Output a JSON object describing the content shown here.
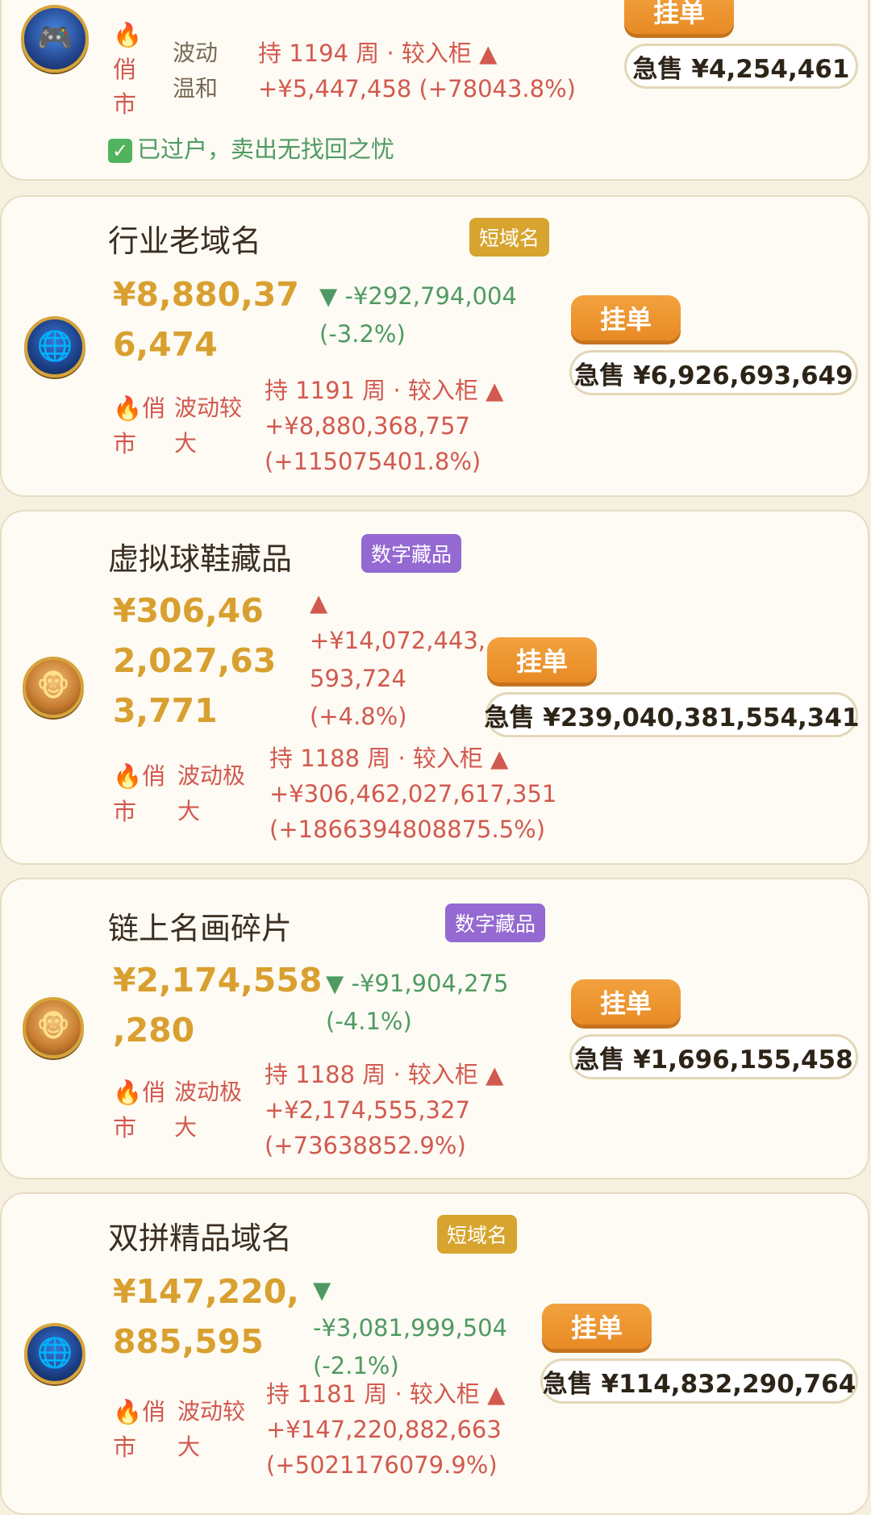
{
  "cards": [
    {
      "title": "",
      "tag": "",
      "price_lines": "",
      "change": "",
      "hot": "🔥\n俏\n市",
      "volatility": "波动\n温和",
      "hold": "持 1194 周 · 较入柜 ▲\n+¥5,447,458 (+78043.8%)",
      "list_label": "挂单",
      "sell_label": "急售 ¥4,254,461",
      "verified": "已过户，卖出无找回之忧",
      "avatar_icon": "gamer-avatar-icon"
    },
    {
      "title": "行业老域名",
      "tag": "短域名",
      "price_lines": "¥8,880,37\n6,474",
      "change": "▼ -¥292,794,004\n(-3.2%)",
      "hot": "🔥俏\n市",
      "volatility": "波动较\n大",
      "hold": "持 1191 周 · 较入柜 ▲\n+¥8,880,368,757\n(+115075401.8%)",
      "list_label": "挂单",
      "sell_label": "急售 ¥6,926,693,649",
      "avatar_icon": "globe-domain-icon"
    },
    {
      "title": "虚拟球鞋藏品",
      "tag": "数字藏品",
      "price_lines": "¥306,46\n2,027,63\n3,771",
      "change": "▲\n+¥14,072,443,\n593,724\n(+4.8%)",
      "hot": "🔥俏\n市",
      "volatility": "波动极\n大",
      "hold": "持 1188 周 · 较入柜 ▲\n+¥306,462,027,617,351\n(+1866394808875.5%)",
      "list_label": "挂单",
      "sell_label": "急售 ¥239,040,381,554,341",
      "avatar_icon": "monkey-nft-icon"
    },
    {
      "title": "链上名画碎片",
      "tag": "数字藏品",
      "price_lines": "¥2,174,558\n,280",
      "change": "▼ -¥91,904,275\n(-4.1%)",
      "hot": "🔥俏\n市",
      "volatility": "波动极\n大",
      "hold": "持 1188 周 · 较入柜 ▲\n+¥2,174,555,327\n(+73638852.9%)",
      "list_label": "挂单",
      "sell_label": "急售 ¥1,696,155,458",
      "avatar_icon": "monkey-nft-icon"
    },
    {
      "title": "双拼精品域名",
      "tag": "短域名",
      "price_lines": "¥147,220,\n885,595",
      "change": "▼\n-¥3,081,999,504\n(-2.1%)",
      "hot": "🔥俏\n市",
      "volatility": "波动较\n大",
      "hold": "持 1181 周 · 较入柜 ▲\n+¥147,220,882,663\n(+5021176079.9%)",
      "list_label": "挂单",
      "sell_label": "急售 ¥114,832,290,764",
      "avatar_icon": "globe-domain-icon"
    }
  ]
}
